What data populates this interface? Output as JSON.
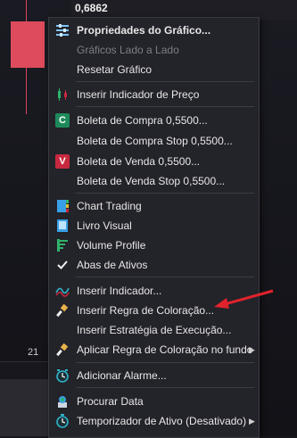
{
  "chart": {
    "price": "0,6862",
    "x_label": "21",
    "candle_color": "#de4b5d"
  },
  "menu": {
    "items": [
      {
        "label": "Propriedades do Gráfico...",
        "icon": "properties-icon"
      },
      {
        "label": "Gráficos Lado a Lado",
        "icon": ""
      },
      {
        "label": "Resetar Gráfico",
        "icon": ""
      },
      {
        "label": "Inserir Indicador de Preço",
        "icon": "price-indicator-icon"
      },
      {
        "label": "Boleta de Compra  0,5500...",
        "icon": "buy-ticket-icon",
        "icon_text": "C"
      },
      {
        "label": "Boleta de Compra Stop  0,5500...",
        "icon": ""
      },
      {
        "label": "Boleta de Venda  0,5500...",
        "icon": "sell-ticket-icon",
        "icon_text": "V"
      },
      {
        "label": "Boleta de Venda Stop  0,5500...",
        "icon": ""
      },
      {
        "label": "Chart Trading",
        "icon": "chart-trading-icon"
      },
      {
        "label": "Livro Visual",
        "icon": "visual-book-icon"
      },
      {
        "label": "Volume Profile",
        "icon": "volume-profile-icon"
      },
      {
        "label": "Abas de Ativos",
        "icon": "check-icon"
      },
      {
        "label": "Inserir Indicador...",
        "icon": "indicator-icon"
      },
      {
        "label": "Inserir Regra de Coloração...",
        "icon": "paint-brush-icon"
      },
      {
        "label": "Inserir Estratégia de Execução...",
        "icon": ""
      },
      {
        "label": "Aplicar Regra de Coloração no fundo",
        "icon": "paint-brush-icon"
      },
      {
        "label": "Adicionar Alarme...",
        "icon": "alarm-icon"
      },
      {
        "label": "Procurar Data",
        "icon": "find-date-icon"
      },
      {
        "label": "Temporizador de Ativo (Desativado)",
        "icon": "timer-icon"
      }
    ]
  },
  "colors": {
    "menu_bg": "#23232a",
    "buy": "#1e8a5a",
    "sell": "#c8293f",
    "annotation_arrow": "#e0232b"
  }
}
